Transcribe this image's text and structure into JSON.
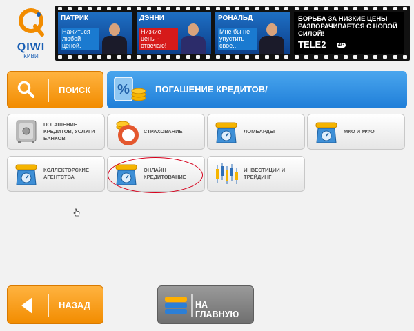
{
  "logo": {
    "text": "QIWI",
    "sub": "КИВИ"
  },
  "banner": {
    "frames": [
      {
        "name": "ПАТРИК",
        "text": "Нажиться любой ценой."
      },
      {
        "name": "ДЭННИ",
        "text": "Низкие цены - отвечаю!"
      },
      {
        "name": "РОНАЛЬД",
        "text": "Мне бы не упустить свое..."
      }
    ],
    "promo_text": "БОРЬБА ЗА НИЗКИЕ ЦЕНЫ РАЗВОРАЧИВАЕТСЯ С НОВОЙ СИЛОЙ!",
    "promo_brand": "TELE2",
    "promo_badge": "4G"
  },
  "search": {
    "label": "ПОИСК"
  },
  "title": {
    "label": "ПОГАШЕНИЕ КРЕДИТОВ/"
  },
  "tiles": [
    {
      "label": "ПОГАШЕНИЕ КРЕДИТОВ, УСЛУГИ БАНКОВ"
    },
    {
      "label": "СТРАХОВАНИЕ"
    },
    {
      "label": "ЛОМБАРДЫ"
    },
    {
      "label": "МКО И МФО"
    },
    {
      "label": "КОЛЛЕКТОРСКИЕ АГЕНТСТВА"
    },
    {
      "label": "ОНЛАЙН КРЕДИТОВАНИЕ"
    },
    {
      "label": "ИНВЕСТИЦИИ И ТРЕЙДИНГ"
    }
  ],
  "nav": {
    "back": "НАЗАД",
    "home": "НА ГЛАВНУЮ"
  },
  "colors": {
    "orange": "#f28c00",
    "blue": "#1f7ed8",
    "highlight": "#d6001c"
  }
}
